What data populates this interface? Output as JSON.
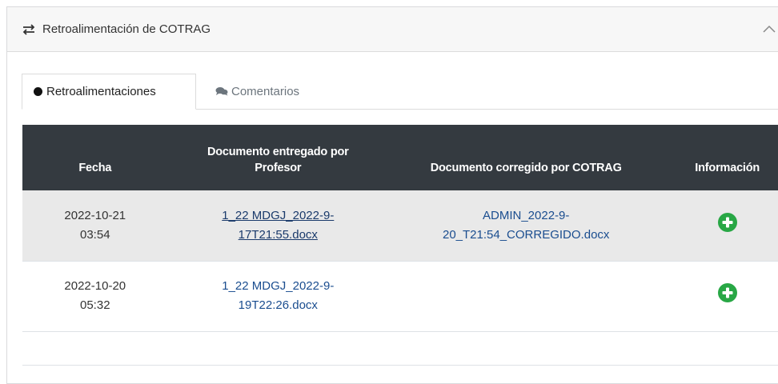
{
  "panel": {
    "title": "Retroalimentación de COTRAG",
    "header_icon": "swap-arrows-icon",
    "collapse_icon": "chevron-up-icon"
  },
  "tabs": [
    {
      "label": "Retroalimentaciones",
      "icon": "dot-icon",
      "active": true
    },
    {
      "label": "Comentarios",
      "icon": "comments-icon",
      "active": false
    }
  ],
  "table": {
    "headers": {
      "fecha": "Fecha",
      "prof_line1": "Documento entregado por",
      "prof_line2": "Profesor",
      "cotrag": "Documento corregido por COTRAG",
      "info": "Información"
    },
    "rows": [
      {
        "date": "2022-10-21",
        "time": "03:54",
        "prof_doc_1": "1_22 MDGJ_2022-9-",
        "prof_doc_2": "17T21:55.docx",
        "cot_doc_1": "ADMIN_2022-9-",
        "cot_doc_2": "20_T21:54_CORREGIDO.docx",
        "info_icon": "plus-circle-icon"
      },
      {
        "date": "2022-10-20",
        "time": "05:32",
        "prof_doc_1": "1_22 MDGJ_2022-9-",
        "prof_doc_2": "19T22:26.docx",
        "cot_doc_1": "",
        "cot_doc_2": "",
        "info_icon": "plus-circle-icon"
      }
    ]
  },
  "colors": {
    "table_header_bg": "#343a40",
    "link": "#1a4d8f",
    "plus_button": "#28a745",
    "striped_row": "#e9e9e9"
  }
}
